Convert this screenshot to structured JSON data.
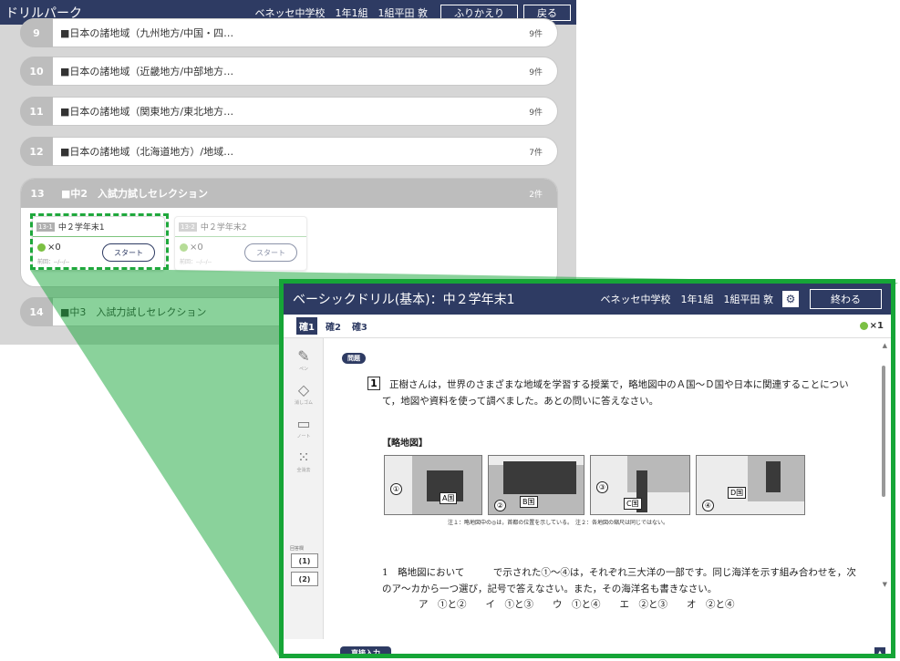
{
  "bg": {
    "app_title": "ドリルパーク",
    "user": "ベネッセ中学校　1年1組　1組平田 敦",
    "review_button": "ふりかえり",
    "back_button": "戻る",
    "units": [
      {
        "num": "9",
        "label": "■日本の諸地域（九州地方/中国・四…",
        "count": "9件"
      },
      {
        "num": "10",
        "label": "■日本の諸地域（近畿地方/中部地方…",
        "count": "9件"
      },
      {
        "num": "11",
        "label": "■日本の諸地域（関東地方/東北地方…",
        "count": "9件"
      },
      {
        "num": "12",
        "label": "■日本の諸地域（北海道地方）/地域…",
        "count": "7件"
      }
    ],
    "open_unit": {
      "num": "13",
      "label": "■中2　入試力試しセレクション",
      "count": "2件"
    },
    "last_unit": {
      "num": "14",
      "label": "■中3　入試力試しセレクション"
    },
    "cards": [
      {
        "tag": "13-1",
        "title": "中２学年末1",
        "gems": "×0",
        "prev": "前回：--/--/--",
        "start": "スタート"
      },
      {
        "tag": "13-2",
        "title": "中２学年末2",
        "gems": "×0",
        "prev": "前回：--/--/--",
        "start": "スタート"
      }
    ]
  },
  "front": {
    "title": "ベーシックドリル(基本)：中２学年末1",
    "user": "ベネッセ中学校　1年1組　1組平田 敦",
    "end_button": "終わる",
    "tabs": [
      "確1",
      "確2",
      "確3"
    ],
    "gem_count": "×1",
    "tools": [
      {
        "icon": "pen-icon",
        "label": "ペン"
      },
      {
        "icon": "eraser-icon",
        "label": "消しゴム"
      },
      {
        "icon": "note-icon",
        "label": "ノート"
      },
      {
        "icon": "fullscreen-icon",
        "label": "全消去"
      }
    ],
    "answer_label": "回答欄",
    "answer_buttons": [
      "(1)",
      "(2)"
    ],
    "mondai_tag": "問題",
    "q_number": "1",
    "q_text": "正樹さんは，世界のさまざまな地域を学習する授業で，略地図中のＡ国〜Ｄ国や日本に関連することについて，地図や資料を使って調べました。あとの問いに答えなさい。",
    "map_title": "【略地図】",
    "map_labels": [
      "①",
      "②",
      "③",
      "④"
    ],
    "country_labels": [
      "A国",
      "B国",
      "C国",
      "D国"
    ],
    "map_note": "注１：略地図中の◎は，首都の位置を示している。　注２：各地図の縮尺は同じではない。",
    "sub_q": "1　略地図において　　　で示された①〜④は，それぞれ三大洋の一部です。同じ海洋を示す組み合わせを，次のア〜カから一つ選び，記号で答えなさい。また，その海洋名も書きなさい。",
    "choices": "ア　①と②　　イ　①と③　　ウ　①と④　　エ　②と③　　オ　②と④",
    "footer_label": "直接入力",
    "to_top": "▲"
  },
  "colors": {
    "header": "#2e3b63",
    "highlight": "#16a537"
  }
}
